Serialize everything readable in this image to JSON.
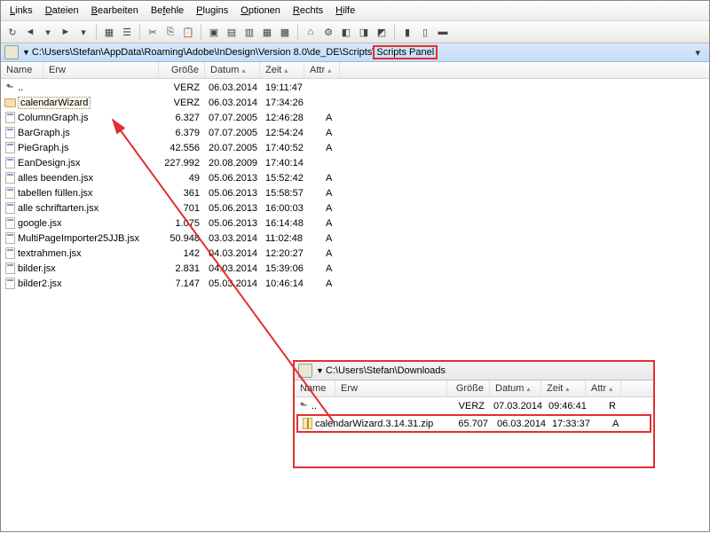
{
  "menu": [
    "Links",
    "Dateien",
    "Bearbeiten",
    "Befehle",
    "Plugins",
    "Optionen",
    "Rechts",
    "Hilfe"
  ],
  "main": {
    "path_prefix": "C:\\Users\\Stefan\\AppData\\Roaming\\Adobe\\InDesign\\Version 8.0\\de_DE\\Scripts\\",
    "path_highlight": "Scripts Panel",
    "cols": {
      "name": "Name",
      "erw": "Erw",
      "size": "Größe",
      "date": "Datum",
      "time": "Zeit",
      "attr": "Attr"
    },
    "up": "..",
    "rows": [
      {
        "icon": "folder",
        "name": "calendarWizard",
        "sel": true,
        "size": "VERZ",
        "date": "06.03.2014",
        "time": "17:34:26",
        "attr": ""
      },
      {
        "icon": "js",
        "name": "ColumnGraph.js",
        "size": "6.327",
        "date": "07.07.2005",
        "time": "12:46:28",
        "attr": "A"
      },
      {
        "icon": "js",
        "name": "BarGraph.js",
        "size": "6.379",
        "date": "07.07.2005",
        "time": "12:54:24",
        "attr": "A"
      },
      {
        "icon": "js",
        "name": "PieGraph.js",
        "size": "42.556",
        "date": "20.07.2005",
        "time": "17:40:52",
        "attr": "A"
      },
      {
        "icon": "js",
        "name": "EanDesign.jsx",
        "size": "227.992",
        "date": "20.08.2009",
        "time": "17:40:14",
        "attr": ""
      },
      {
        "icon": "js",
        "name": "alles beenden.jsx",
        "size": "49",
        "date": "05.06.2013",
        "time": "15:52:42",
        "attr": "A"
      },
      {
        "icon": "js",
        "name": "tabellen füllen.jsx",
        "size": "361",
        "date": "05.06.2013",
        "time": "15:58:57",
        "attr": "A"
      },
      {
        "icon": "js",
        "name": "alle schriftarten.jsx",
        "size": "701",
        "date": "05.06.2013",
        "time": "16:00:03",
        "attr": "A"
      },
      {
        "icon": "js",
        "name": "google.jsx",
        "size": "1.075",
        "date": "05.06.2013",
        "time": "16:14:48",
        "attr": "A"
      },
      {
        "icon": "js",
        "name": "MultiPageImporter25JJB.jsx",
        "size": "50.948",
        "date": "03.03.2014",
        "time": "11:02:48",
        "attr": "A"
      },
      {
        "icon": "js",
        "name": "textrahmen.jsx",
        "size": "142",
        "date": "04.03.2014",
        "time": "12:20:27",
        "attr": "A"
      },
      {
        "icon": "js",
        "name": "bilder.jsx",
        "size": "2.831",
        "date": "04.03.2014",
        "time": "15:39:06",
        "attr": "A"
      },
      {
        "icon": "js",
        "name": "bilder2.jsx",
        "size": "7.147",
        "date": "05.03.2014",
        "time": "10:46:14",
        "attr": "A"
      }
    ],
    "up_row": {
      "size": "VERZ",
      "date": "06.03.2014",
      "time": "19:11:47",
      "attr": ""
    }
  },
  "second": {
    "path": "C:\\Users\\Stefan\\Downloads",
    "cols": {
      "name": "Name",
      "erw": "Erw",
      "size": "Größe",
      "date": "Datum",
      "time": "Zeit",
      "attr": "Attr"
    },
    "up": "..",
    "up_row": {
      "size": "VERZ",
      "date": "07.03.2014",
      "time": "09:46:41",
      "attr": "R"
    },
    "rows": [
      {
        "icon": "zip",
        "name": "calendarWizard.3.14.31.zip",
        "size": "65.707",
        "date": "06.03.2014",
        "time": "17:33:37",
        "attr": "A"
      }
    ]
  }
}
